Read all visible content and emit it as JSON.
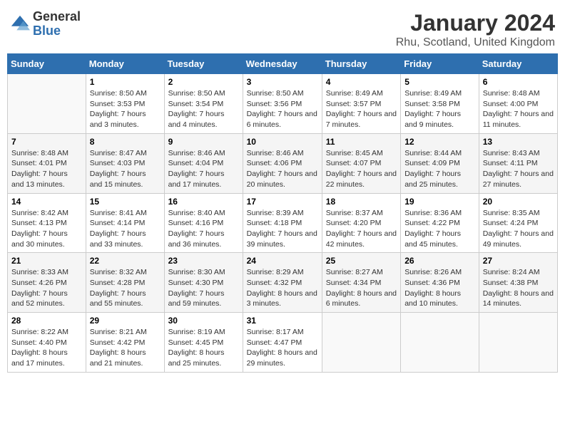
{
  "logo": {
    "general": "General",
    "blue": "Blue"
  },
  "title": "January 2024",
  "subtitle": "Rhu, Scotland, United Kingdom",
  "days_header": [
    "Sunday",
    "Monday",
    "Tuesday",
    "Wednesday",
    "Thursday",
    "Friday",
    "Saturday"
  ],
  "weeks": [
    [
      {
        "day": "",
        "sunrise": "",
        "sunset": "",
        "daylight": ""
      },
      {
        "day": "1",
        "sunrise": "Sunrise: 8:50 AM",
        "sunset": "Sunset: 3:53 PM",
        "daylight": "Daylight: 7 hours and 3 minutes."
      },
      {
        "day": "2",
        "sunrise": "Sunrise: 8:50 AM",
        "sunset": "Sunset: 3:54 PM",
        "daylight": "Daylight: 7 hours and 4 minutes."
      },
      {
        "day": "3",
        "sunrise": "Sunrise: 8:50 AM",
        "sunset": "Sunset: 3:56 PM",
        "daylight": "Daylight: 7 hours and 6 minutes."
      },
      {
        "day": "4",
        "sunrise": "Sunrise: 8:49 AM",
        "sunset": "Sunset: 3:57 PM",
        "daylight": "Daylight: 7 hours and 7 minutes."
      },
      {
        "day": "5",
        "sunrise": "Sunrise: 8:49 AM",
        "sunset": "Sunset: 3:58 PM",
        "daylight": "Daylight: 7 hours and 9 minutes."
      },
      {
        "day": "6",
        "sunrise": "Sunrise: 8:48 AM",
        "sunset": "Sunset: 4:00 PM",
        "daylight": "Daylight: 7 hours and 11 minutes."
      }
    ],
    [
      {
        "day": "7",
        "sunrise": "Sunrise: 8:48 AM",
        "sunset": "Sunset: 4:01 PM",
        "daylight": "Daylight: 7 hours and 13 minutes."
      },
      {
        "day": "8",
        "sunrise": "Sunrise: 8:47 AM",
        "sunset": "Sunset: 4:03 PM",
        "daylight": "Daylight: 7 hours and 15 minutes."
      },
      {
        "day": "9",
        "sunrise": "Sunrise: 8:46 AM",
        "sunset": "Sunset: 4:04 PM",
        "daylight": "Daylight: 7 hours and 17 minutes."
      },
      {
        "day": "10",
        "sunrise": "Sunrise: 8:46 AM",
        "sunset": "Sunset: 4:06 PM",
        "daylight": "Daylight: 7 hours and 20 minutes."
      },
      {
        "day": "11",
        "sunrise": "Sunrise: 8:45 AM",
        "sunset": "Sunset: 4:07 PM",
        "daylight": "Daylight: 7 hours and 22 minutes."
      },
      {
        "day": "12",
        "sunrise": "Sunrise: 8:44 AM",
        "sunset": "Sunset: 4:09 PM",
        "daylight": "Daylight: 7 hours and 25 minutes."
      },
      {
        "day": "13",
        "sunrise": "Sunrise: 8:43 AM",
        "sunset": "Sunset: 4:11 PM",
        "daylight": "Daylight: 7 hours and 27 minutes."
      }
    ],
    [
      {
        "day": "14",
        "sunrise": "Sunrise: 8:42 AM",
        "sunset": "Sunset: 4:13 PM",
        "daylight": "Daylight: 7 hours and 30 minutes."
      },
      {
        "day": "15",
        "sunrise": "Sunrise: 8:41 AM",
        "sunset": "Sunset: 4:14 PM",
        "daylight": "Daylight: 7 hours and 33 minutes."
      },
      {
        "day": "16",
        "sunrise": "Sunrise: 8:40 AM",
        "sunset": "Sunset: 4:16 PM",
        "daylight": "Daylight: 7 hours and 36 minutes."
      },
      {
        "day": "17",
        "sunrise": "Sunrise: 8:39 AM",
        "sunset": "Sunset: 4:18 PM",
        "daylight": "Daylight: 7 hours and 39 minutes."
      },
      {
        "day": "18",
        "sunrise": "Sunrise: 8:37 AM",
        "sunset": "Sunset: 4:20 PM",
        "daylight": "Daylight: 7 hours and 42 minutes."
      },
      {
        "day": "19",
        "sunrise": "Sunrise: 8:36 AM",
        "sunset": "Sunset: 4:22 PM",
        "daylight": "Daylight: 7 hours and 45 minutes."
      },
      {
        "day": "20",
        "sunrise": "Sunrise: 8:35 AM",
        "sunset": "Sunset: 4:24 PM",
        "daylight": "Daylight: 7 hours and 49 minutes."
      }
    ],
    [
      {
        "day": "21",
        "sunrise": "Sunrise: 8:33 AM",
        "sunset": "Sunset: 4:26 PM",
        "daylight": "Daylight: 7 hours and 52 minutes."
      },
      {
        "day": "22",
        "sunrise": "Sunrise: 8:32 AM",
        "sunset": "Sunset: 4:28 PM",
        "daylight": "Daylight: 7 hours and 55 minutes."
      },
      {
        "day": "23",
        "sunrise": "Sunrise: 8:30 AM",
        "sunset": "Sunset: 4:30 PM",
        "daylight": "Daylight: 7 hours and 59 minutes."
      },
      {
        "day": "24",
        "sunrise": "Sunrise: 8:29 AM",
        "sunset": "Sunset: 4:32 PM",
        "daylight": "Daylight: 8 hours and 3 minutes."
      },
      {
        "day": "25",
        "sunrise": "Sunrise: 8:27 AM",
        "sunset": "Sunset: 4:34 PM",
        "daylight": "Daylight: 8 hours and 6 minutes."
      },
      {
        "day": "26",
        "sunrise": "Sunrise: 8:26 AM",
        "sunset": "Sunset: 4:36 PM",
        "daylight": "Daylight: 8 hours and 10 minutes."
      },
      {
        "day": "27",
        "sunrise": "Sunrise: 8:24 AM",
        "sunset": "Sunset: 4:38 PM",
        "daylight": "Daylight: 8 hours and 14 minutes."
      }
    ],
    [
      {
        "day": "28",
        "sunrise": "Sunrise: 8:22 AM",
        "sunset": "Sunset: 4:40 PM",
        "daylight": "Daylight: 8 hours and 17 minutes."
      },
      {
        "day": "29",
        "sunrise": "Sunrise: 8:21 AM",
        "sunset": "Sunset: 4:42 PM",
        "daylight": "Daylight: 8 hours and 21 minutes."
      },
      {
        "day": "30",
        "sunrise": "Sunrise: 8:19 AM",
        "sunset": "Sunset: 4:45 PM",
        "daylight": "Daylight: 8 hours and 25 minutes."
      },
      {
        "day": "31",
        "sunrise": "Sunrise: 8:17 AM",
        "sunset": "Sunset: 4:47 PM",
        "daylight": "Daylight: 8 hours and 29 minutes."
      },
      {
        "day": "",
        "sunrise": "",
        "sunset": "",
        "daylight": ""
      },
      {
        "day": "",
        "sunrise": "",
        "sunset": "",
        "daylight": ""
      },
      {
        "day": "",
        "sunrise": "",
        "sunset": "",
        "daylight": ""
      }
    ]
  ]
}
